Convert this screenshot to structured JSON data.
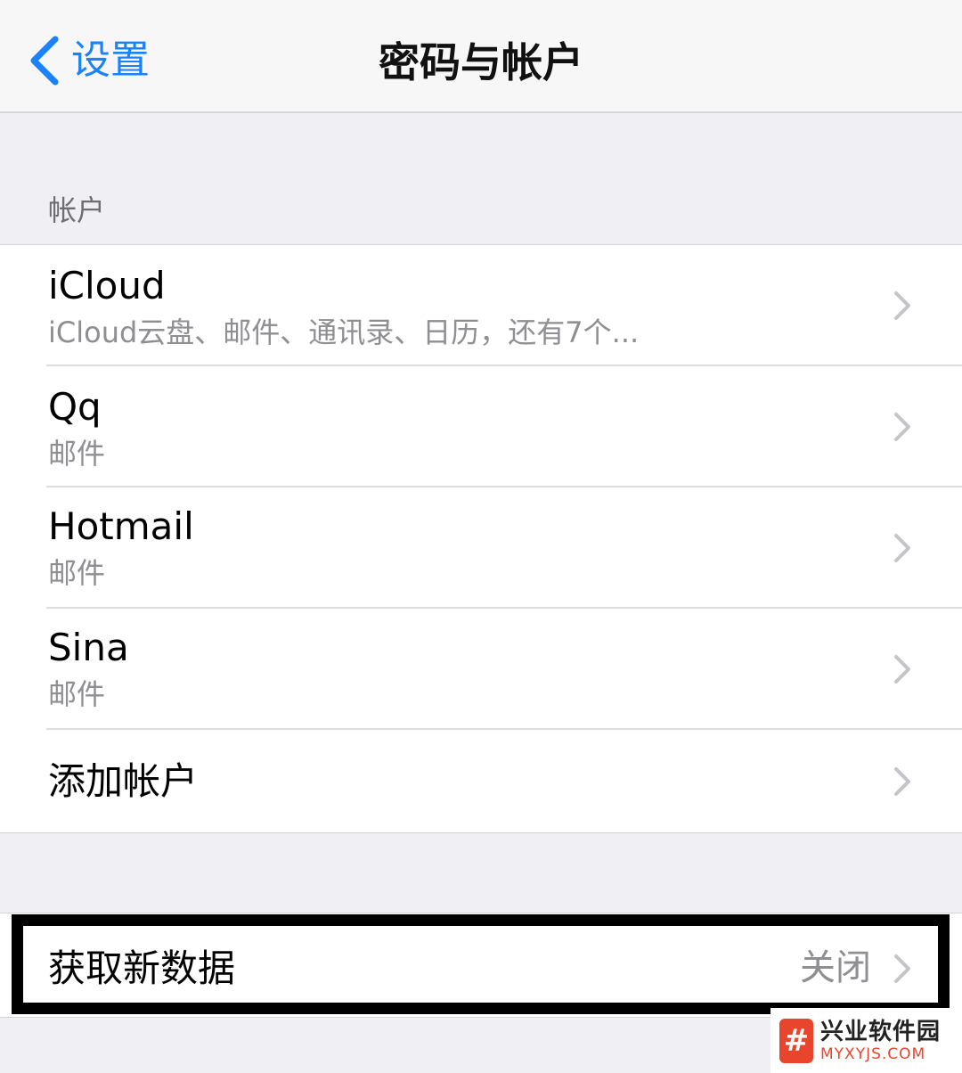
{
  "navbar": {
    "back_label": "设置",
    "title": "密码与帐户"
  },
  "accounts_section": {
    "header": "帐户",
    "items": [
      {
        "title": "iCloud",
        "subtitle": "iCloud云盘、邮件、通讯录、日历，还有7个..."
      },
      {
        "title": "Qq",
        "subtitle": "邮件"
      },
      {
        "title": "Hotmail",
        "subtitle": "邮件"
      },
      {
        "title": "Sina",
        "subtitle": "邮件"
      },
      {
        "title": "添加帐户",
        "subtitle": ""
      }
    ]
  },
  "fetch_row": {
    "title": "获取新数据",
    "value": "关闭"
  },
  "watermark": {
    "logo_glyph": "#",
    "name": "兴业软件园",
    "domain": "MYXYJS.COM"
  },
  "colors": {
    "accent": "#1a82fb",
    "secondary_text": "#8e8e93",
    "chevron": "#c4c4c9",
    "background": "#efeff4",
    "highlight_border": "#000000"
  },
  "icons": {
    "back": "chevron-left-icon",
    "disclosure": "chevron-right-icon"
  }
}
